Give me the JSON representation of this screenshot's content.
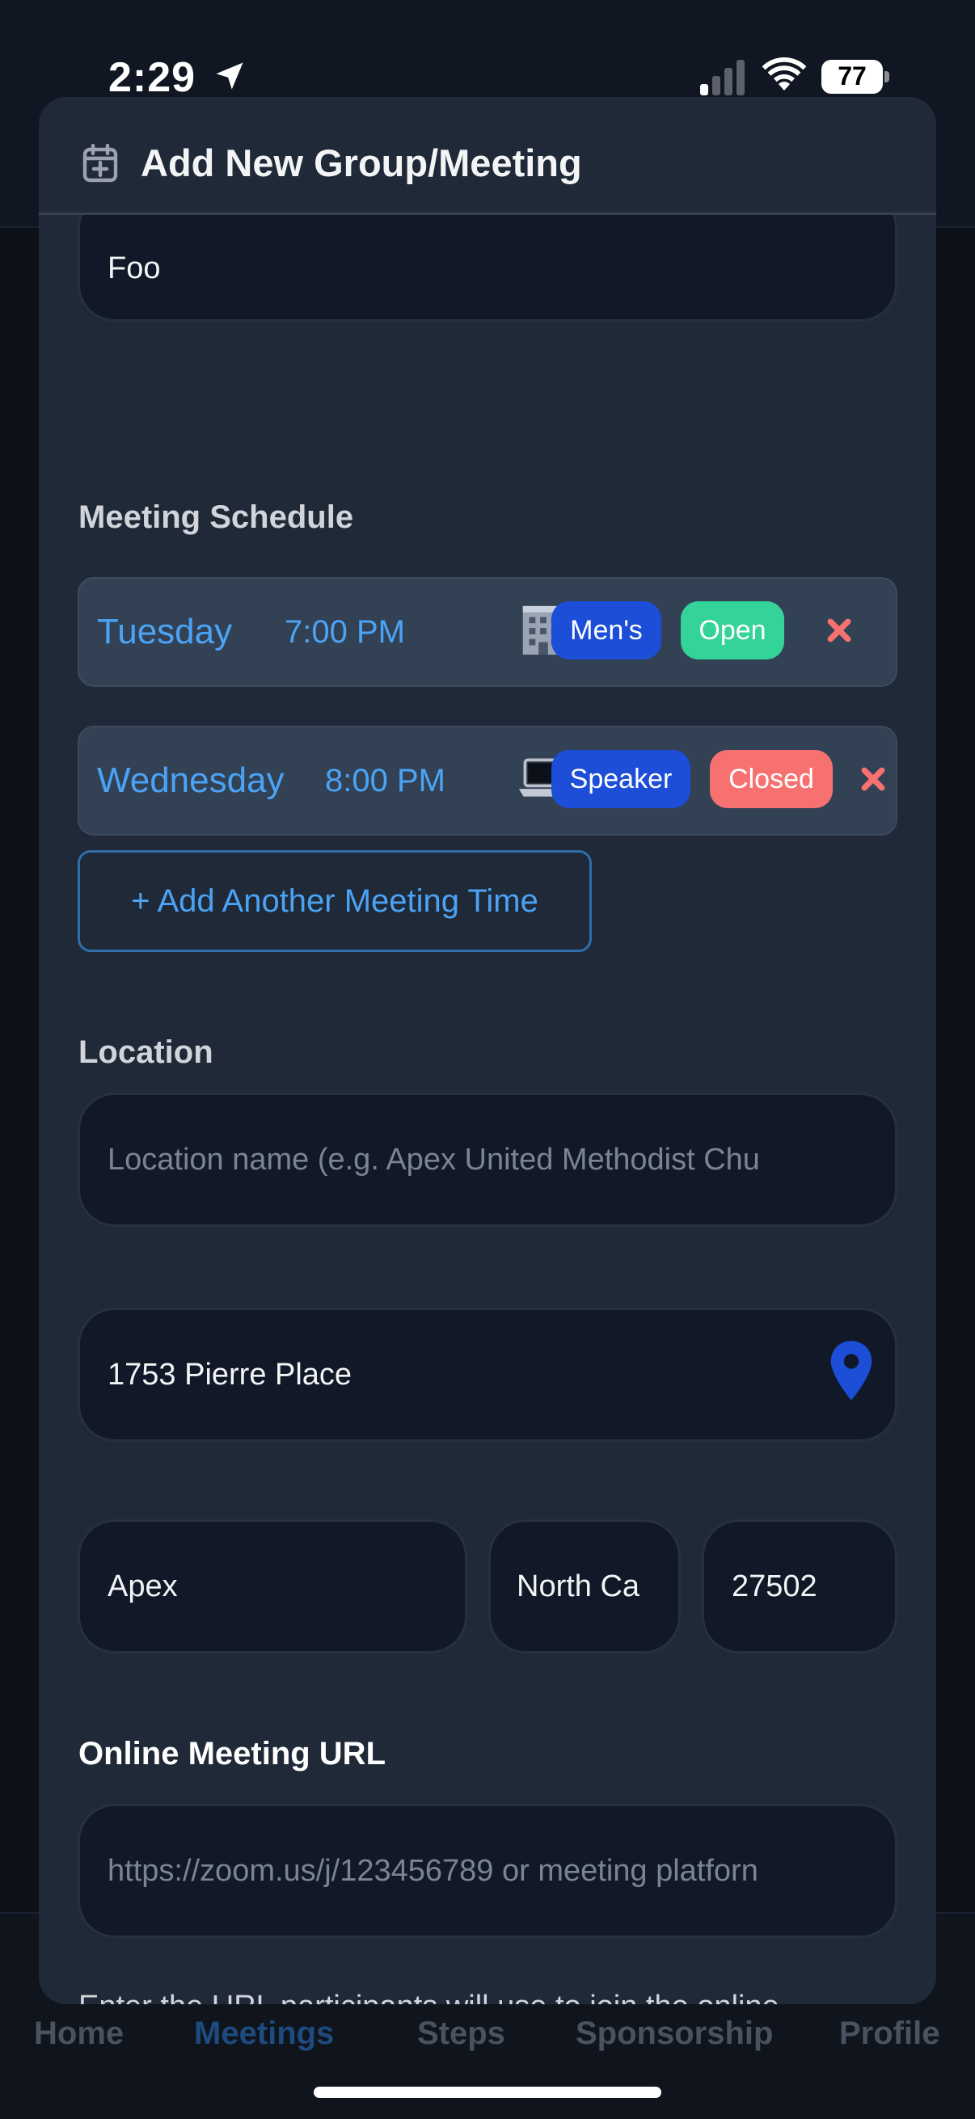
{
  "status_bar": {
    "time": "2:29",
    "battery": "77"
  },
  "background_app": {
    "tabs": [
      "Home",
      "Meetings",
      "Steps",
      "Sponsorship",
      "Profile"
    ],
    "active_tab": "Meetings"
  },
  "modal": {
    "title": "Add New Group/Meeting",
    "name_value": "Foo",
    "schedule": {
      "label": "Meeting Schedule",
      "rows": [
        {
          "day": "Tuesday",
          "time": "7:00 PM",
          "format_icon": "building-icon",
          "type": "Men's",
          "access": "Open",
          "access_color": "#34d399"
        },
        {
          "day": "Wednesday",
          "time": "8:00 PM",
          "format_icon": "laptop-icon",
          "type": "Speaker",
          "access": "Closed",
          "access_color": "#f87171"
        }
      ],
      "add_button": "+ Add Another Meeting Time"
    },
    "location": {
      "label": "Location",
      "name_placeholder": "Location name (e.g. Apex United Methodist Chu",
      "address": "1753 Pierre Place",
      "city": "Apex",
      "state": "North Ca",
      "zip": "27502"
    },
    "online": {
      "label": "Online Meeting URL",
      "url_placeholder": "https://zoom.us/j/123456789 or meeting platforn",
      "help": "Enter the URL participants will use to join the online meeting."
    }
  },
  "colors": {
    "accent": "#4ba3f5",
    "badge_blue": "#1d4ed8",
    "open_green": "#34d399",
    "closed_red": "#f87171",
    "modal_bg": "#1f2937",
    "field_bg": "#111827"
  }
}
